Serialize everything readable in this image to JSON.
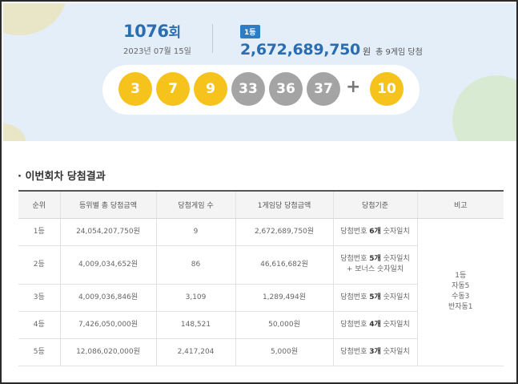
{
  "round": {
    "number": "1076",
    "unit": "회",
    "date": "2023년 07월 15일"
  },
  "prize": {
    "rank_badge": "1등",
    "amount": "2,672,689,750",
    "unit": "원",
    "winners": "총 9게임 당첨"
  },
  "balls": [
    {
      "value": "3",
      "color": "#f6c31c"
    },
    {
      "value": "7",
      "color": "#f6c31c"
    },
    {
      "value": "9",
      "color": "#f6c31c"
    },
    {
      "value": "33",
      "color": "#a4a4a4"
    },
    {
      "value": "36",
      "color": "#a4a4a4"
    },
    {
      "value": "37",
      "color": "#a4a4a4"
    }
  ],
  "plus": "+",
  "bonus": {
    "value": "10",
    "color": "#f6c31c"
  },
  "section_title": "· 이번회차 당첨결과",
  "table": {
    "headers": [
      "순위",
      "등위별 총 당첨금액",
      "당첨게임 수",
      "1게임당 당첨금액",
      "당첨기준",
      "비고"
    ],
    "rows": [
      {
        "rank": "1등",
        "total": "24,054,207,750원",
        "games": "9",
        "per_game": "2,672,689,750원",
        "crit_a": "당첨번호 ",
        "crit_b": "6개",
        "crit_c": " 숫자일치",
        "crit_2": ""
      },
      {
        "rank": "2등",
        "total": "4,009,034,652원",
        "games": "86",
        "per_game": "46,616,682원",
        "crit_a": "당첨번호 ",
        "crit_b": "5개",
        "crit_c": " 숫자일치",
        "crit_2": "+ 보너스 숫자일치"
      },
      {
        "rank": "3등",
        "total": "4,009,036,846원",
        "games": "3,109",
        "per_game": "1,289,494원",
        "crit_a": "당첨번호 ",
        "crit_b": "5개",
        "crit_c": " 숫자일치",
        "crit_2": ""
      },
      {
        "rank": "4등",
        "total": "7,426,050,000원",
        "games": "148,521",
        "per_game": "50,000원",
        "crit_a": "당첨번호 ",
        "crit_b": "4개",
        "crit_c": " 숫자일치",
        "crit_2": ""
      },
      {
        "rank": "5등",
        "total": "12,086,020,000원",
        "games": "2,417,204",
        "per_game": "5,000원",
        "crit_a": "당첨번호 ",
        "crit_b": "3개",
        "crit_c": " 숫자일치",
        "crit_2": ""
      }
    ],
    "note": [
      "1등",
      "자동5",
      "수동3",
      "반자동1"
    ]
  }
}
